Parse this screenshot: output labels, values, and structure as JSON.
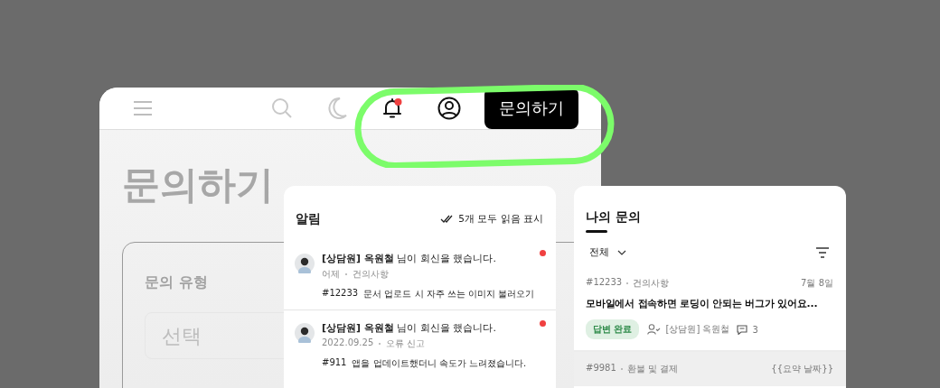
{
  "header": {
    "has_unread": true,
    "button": "문의하기"
  },
  "page_title": "문의하기",
  "form": {
    "field_label": "문의 유형",
    "select": {
      "placeholder": "선택"
    }
  },
  "notifications": {
    "title": "알림",
    "mark_all": "5개 모두 읽음 표시",
    "items": [
      {
        "message": "**[상담원] 옥원철** 님이 회신을 했습니다.",
        "time": "어제",
        "category": "건의사항",
        "number": "#12233",
        "subject": "문서 업로드 시 자주 쓰는 이미지 불러오기",
        "unread": true
      },
      {
        "message": "**[상담원] 옥원철** 님이 회신을 했습니다.",
        "time": "2022.09.25",
        "category": "오류 신고",
        "number": "#911",
        "subject": "앱을 업데이트했더니 속도가 느려졌습니다.",
        "unread": true
      }
    ]
  },
  "inquiries": {
    "title": "나의 문의",
    "filter": "전체",
    "items": [
      {
        "number": "#12233",
        "category": "건의사항",
        "date": "7월 8일",
        "title": "모바일에서 접속하면 로딩이 안되는 버그가 있어요...",
        "status": "답변 완료",
        "assignee": "[상담원] 옥원철",
        "comments": "3",
        "selected": false
      },
      {
        "number": "#9981",
        "category": "환불 및 결제",
        "date": "{{요약 날짜}}",
        "selected": true
      }
    ]
  }
}
